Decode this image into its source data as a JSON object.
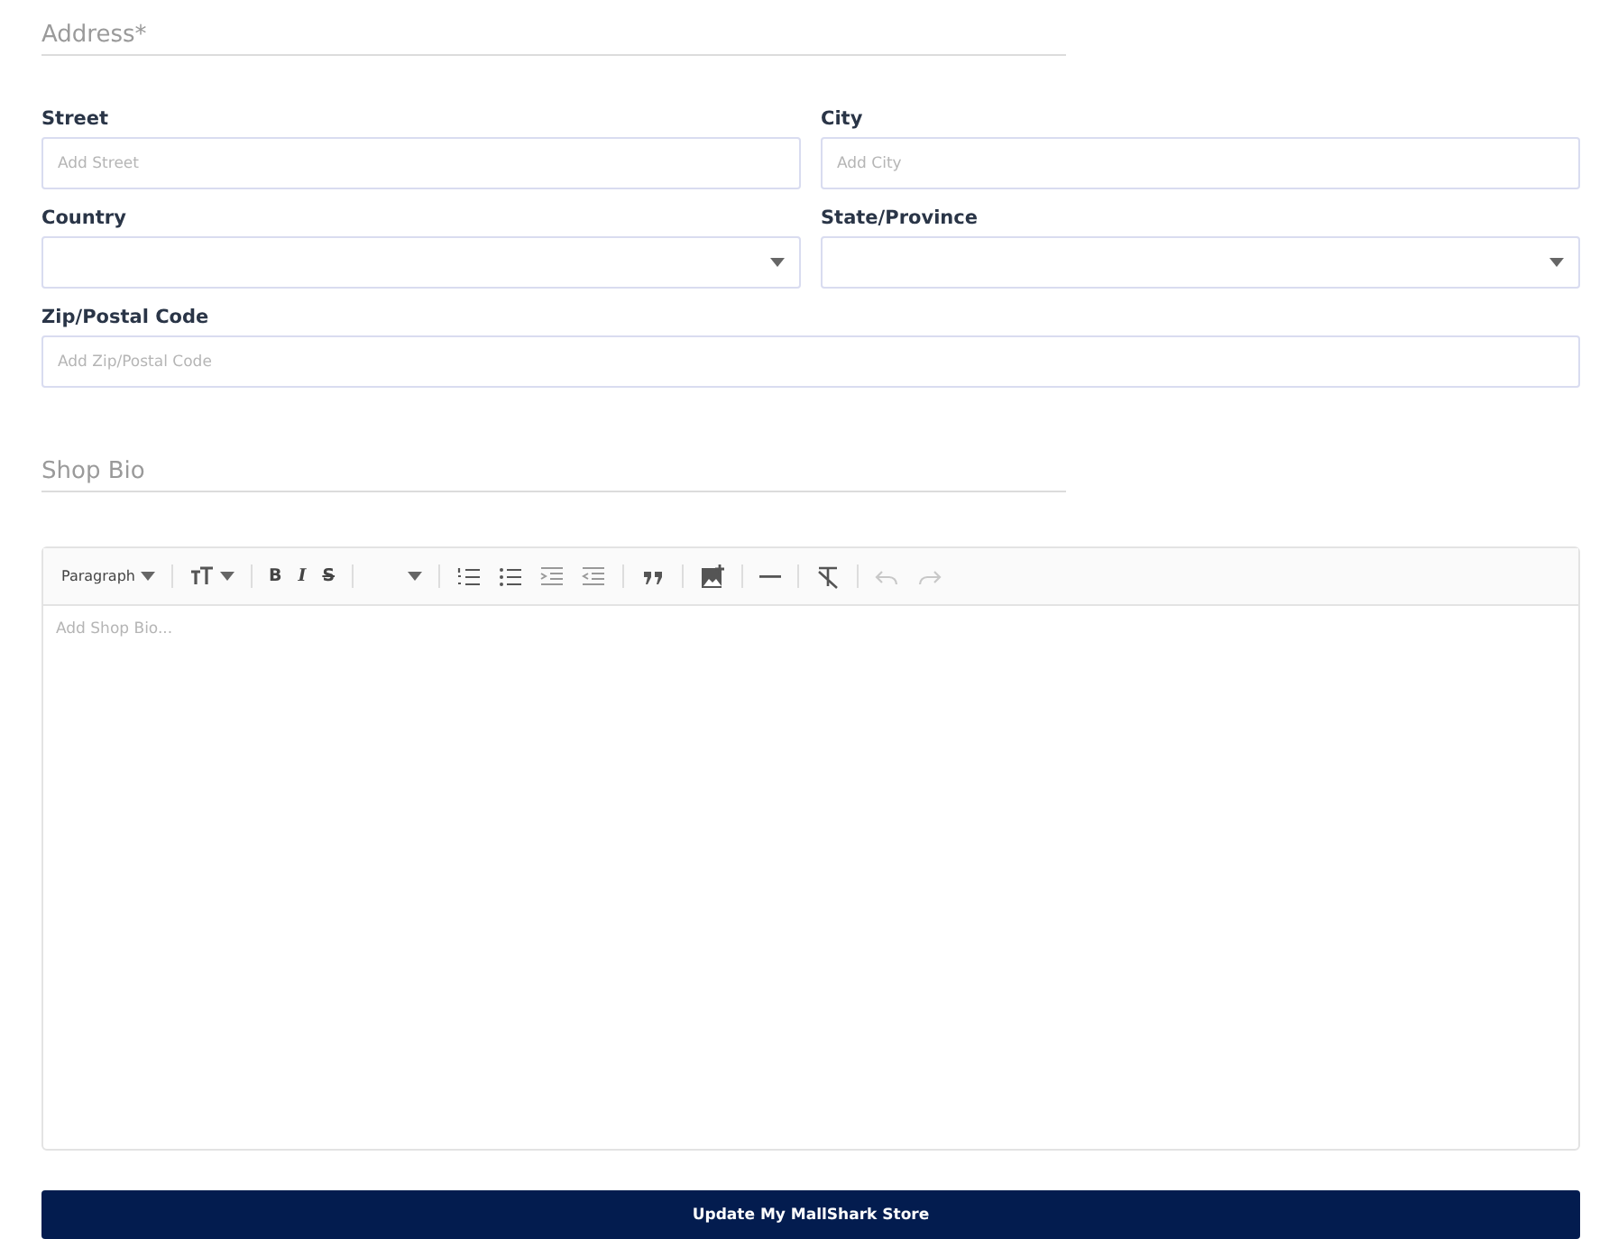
{
  "address_section": {
    "title": "Address*"
  },
  "fields": [
    {
      "kind": "text",
      "label": "Street",
      "placeholder": "Add Street"
    },
    {
      "kind": "text",
      "label": "City",
      "placeholder": "Add City"
    },
    {
      "kind": "select",
      "label": "Country"
    },
    {
      "kind": "select",
      "label": "State/Province"
    },
    {
      "kind": "text",
      "label": "Zip/Postal Code",
      "placeholder": "Add Zip/Postal Code"
    }
  ],
  "bio_section": {
    "title": "Shop Bio"
  },
  "editor": {
    "toolbar": [
      {
        "kind": "dropdown",
        "label": "Paragraph"
      },
      {
        "kind": "sep"
      },
      {
        "kind": "fontsize"
      },
      {
        "kind": "sep"
      },
      {
        "kind": "bold",
        "label": "B"
      },
      {
        "kind": "italic",
        "label": "I"
      },
      {
        "kind": "strike",
        "label": "S"
      },
      {
        "kind": "sep"
      },
      {
        "kind": "dropdown"
      },
      {
        "kind": "sep"
      },
      {
        "kind": "ol"
      },
      {
        "kind": "ul"
      },
      {
        "kind": "indent"
      },
      {
        "kind": "outdent"
      },
      {
        "kind": "sep"
      },
      {
        "kind": "quote"
      },
      {
        "kind": "sep"
      },
      {
        "kind": "image"
      },
      {
        "kind": "sep"
      },
      {
        "kind": "hr"
      },
      {
        "kind": "sep"
      },
      {
        "kind": "clear"
      },
      {
        "kind": "sep"
      },
      {
        "kind": "undo",
        "disabled": true
      },
      {
        "kind": "redo",
        "disabled": true
      }
    ],
    "placeholder": "Add Shop Bio..."
  },
  "submit_button": {
    "label": "Update My MallShark Store"
  }
}
